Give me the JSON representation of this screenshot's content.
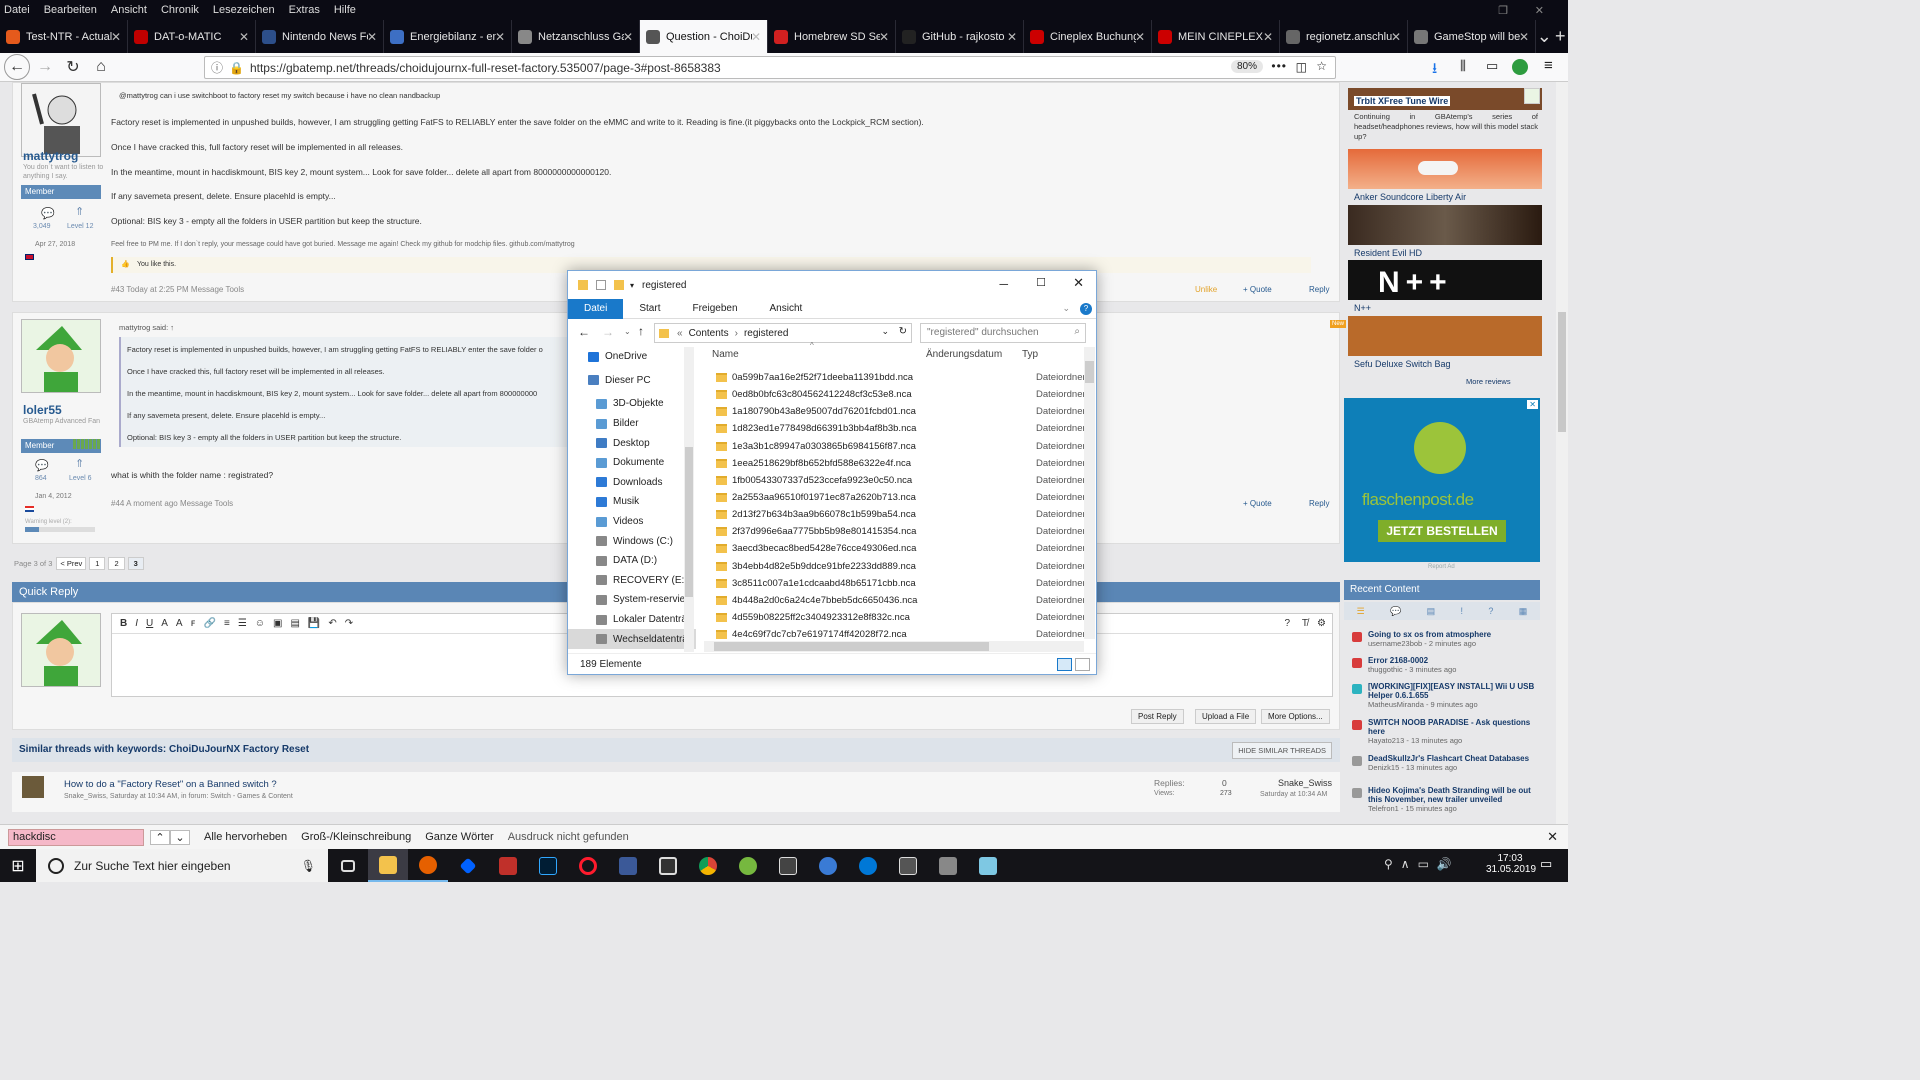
{
  "browser": {
    "menu": [
      "Datei",
      "Bearbeiten",
      "Ansicht",
      "Chronik",
      "Lesezeichen",
      "Extras",
      "Hilfe"
    ],
    "tabs": [
      {
        "label": "Test-NTR - Actual",
        "color": "#e55a1c"
      },
      {
        "label": "DAT-o-MATIC",
        "color": "#c00000"
      },
      {
        "label": "Nintendo News Fo",
        "color": "#2d4f8a"
      },
      {
        "label": "Energiebilanz - en",
        "color": "#3d6fc4"
      },
      {
        "label": "Netzanschluss Gas | Re",
        "color": "#888888"
      },
      {
        "label": "Question - ChoiDu",
        "color": "#555555",
        "active": true
      },
      {
        "label": "Homebrew SD Set",
        "color": "#d02020"
      },
      {
        "label": "GitHub - rajkosto",
        "color": "#222222"
      },
      {
        "label": "Cineplex Buchung",
        "color": "#cc0000"
      },
      {
        "label": "MEIN CINEPLEX -",
        "color": "#cc0000"
      },
      {
        "label": "regionetz.anschluss.to",
        "color": "#666666"
      },
      {
        "label": "GameStop will be",
        "color": "#777777"
      }
    ],
    "url": "https://gbatemp.net/threads/choidujournx-full-reset-factory.535007/page-3#post-8658383",
    "zoom": "80%"
  },
  "post1": {
    "user": "mattytrog",
    "user_title": "You don`t want to listen to anything I say.",
    "rank": "Member",
    "messages": "3,049",
    "level": "Level 12",
    "joined": "Apr 27, 2018",
    "quote_line": "@mattytrog can i use switchboot to factory reset my switch because i have no clean nandbackup",
    "lines": [
      "Factory reset is implemented in unpushed builds, however, I am struggling getting FatFS to RELIABLY enter the save folder on the eMMC and write to it. Reading is fine.(it piggybacks onto the Lockpick_RCM section).",
      "Once I have cracked this, full factory reset will be implemented in all releases.",
      "In the meantime, mount in hacdiskmount, BIS key 2, mount system... Look for save folder... delete all apart from 8000000000000120.",
      "If any savemeta present, delete. Ensure placehld is empty...",
      "Optional: BIS key 3 - empty all the folders in USER partition but keep the structure."
    ],
    "signature": "Feel free to PM me. If I don`t reply, your message could have got buried. Message me again! Check my github for modchip files. github.com/mattytrog",
    "likes": "You like this.",
    "footer": "#43   Today at 2:25 PM   Message Tools",
    "actions": [
      "Unlike",
      "+ Quote",
      "Reply"
    ]
  },
  "post2": {
    "user": "loler55",
    "user_title": "GBAtemp Advanced Fan",
    "rank": "Member",
    "messages": "864",
    "level": "Level 6",
    "joined": "Jan 4, 2012",
    "warning": "Warning level (2):",
    "quote_head": "mattytrog said: ↑",
    "quote_lines": [
      "Factory reset is implemented in unpushed builds, however, I am struggling getting FatFS to RELIABLY enter the save folder o",
      "Once I have cracked this, full factory reset will be implemented in all releases.",
      "In the meantime, mount in hacdiskmount, BIS key 2, mount system... Look for save folder... delete all apart from 800000000",
      "If any savemeta present, delete. Ensure placehld is empty...",
      "Optional: BIS key 3 - empty all the folders in USER partition but keep the structure."
    ],
    "text": "what is whith the folder name : registrated?",
    "footer": "#44   A moment ago   Message Tools",
    "actions": [
      "+ Quote",
      "Reply"
    ]
  },
  "pagination": {
    "label": "Page 3 of 3",
    "prev": "< Prev",
    "pages": [
      "1",
      "2",
      "3"
    ]
  },
  "quick_reply": {
    "title": "Quick Reply",
    "buttons": [
      "Post Reply",
      "Upload a File",
      "More Options..."
    ]
  },
  "similar": {
    "title": "Similar threads with keywords: ChoiDuJourNX Factory Reset",
    "hide": "HIDE SIMILAR THREADS",
    "thread_title": "How to do a \"Factory Reset\" on a Banned switch ?",
    "thread_meta": "Snake_Swiss, Saturday at 10:34 AM, in forum: Switch - Games & Content",
    "replies_label": "Replies:",
    "replies": "0",
    "views_label": "Views:",
    "views": "273",
    "last_user": "Snake_Swiss",
    "last_time": "Saturday at 10:34 AM"
  },
  "sidebar": {
    "reviews": [
      {
        "title": "Trblt XFree Tune Wire",
        "desc": "Continuing in GBAtemp's series of headset/headphones reviews, how will this model stack up?"
      },
      {
        "title": "Anker Soundcore Liberty Air"
      },
      {
        "title": "Resident Evil HD"
      },
      {
        "title": "N++"
      },
      {
        "title": "Sefu Deluxe Switch Bag"
      }
    ],
    "more_reviews": "More reviews",
    "new_badge": "New",
    "ad_brand": "flaschenpost.de",
    "ad_button": "JETZT BESTELLEN",
    "ad_report": "Report Ad",
    "recent_title": "Recent Content",
    "recent": [
      {
        "title": "Going to sx os from atmosphere",
        "meta": "username23bob - 2 minutes ago"
      },
      {
        "title": "Error 2168-0002",
        "meta": "thuggothic - 3 minutes ago"
      },
      {
        "title": "[WORKING][FIX][EASY INSTALL] Wii U USB Helper 0.6.1.655",
        "meta": "MatheusMiranda - 9 minutes ago"
      },
      {
        "title": "SWITCH NOOB PARADISE - Ask questions here",
        "meta": "Hayato213 - 13 minutes ago"
      },
      {
        "title": "DeadSkullzJr's Flashcart Cheat Databases",
        "meta": "Denizk15 - 13 minutes ago"
      },
      {
        "title": "Hideo Kojima's Death Stranding will be out this November, new trailer unveiled",
        "meta": "Telefron1 - 15 minutes ago"
      }
    ]
  },
  "explorer": {
    "title": "registered",
    "ribbon": [
      "Datei",
      "Start",
      "Freigeben",
      "Ansicht"
    ],
    "breadcrumb": [
      "Contents",
      "registered"
    ],
    "search_placeholder": "\"registered\" durchsuchen",
    "columns": [
      "Name",
      "Änderungsdatum",
      "Typ"
    ],
    "nav": [
      "OneDrive",
      "Dieser PC",
      "3D-Objekte",
      "Bilder",
      "Desktop",
      "Dokumente",
      "Downloads",
      "Musik",
      "Videos",
      "Windows (C:)",
      "DATA (D:)",
      "RECOVERY (E:)",
      "System-reservier",
      "Lokaler Datenträ",
      "Wechseldatenträ"
    ],
    "files": [
      "0a599b7aa16e2f52f71deeba11391bdd.nca",
      "0ed8b0bfc63c804562412248cf3c53e8.nca",
      "1a180790b43a8e95007dd76201fcbd01.nca",
      "1d823ed1e778498d66391b3bb4af8b3b.nca",
      "1e3a3b1c89947a0303865b6984156f87.nca",
      "1eea2518629bf8b652bfd588e6322e4f.nca",
      "1fb00543307337d523ccefa9923e0c50.nca",
      "2a2553aa96510f01971ec87a2620b713.nca",
      "2d13f27b634b3aa9b66078c1b599ba54.nca",
      "2f37d996e6aa7775bb5b98e801415354.nca",
      "3aecd3becac8bed5428e76cce49306ed.nca",
      "3b4ebb4d82e5b9ddce91bfe2233dd889.nca",
      "3c8511c007a1e1cdcaabd48b65171cbb.nca",
      "4b448a2d0c6a24c4e7bbeb5dc6650436.nca",
      "4d559b08225ff2c3404923312e8f832c.nca",
      "4e4c69f7dc7cb7e6197174ff42028f72.nca"
    ],
    "file_type": "Dateiordner",
    "status": "189 Elemente"
  },
  "findbar": {
    "value": "hackdisc",
    "options": [
      "Alle hervorheben",
      "Groß-/Kleinschreibung",
      "Ganze Wörter"
    ],
    "result": "Ausdruck nicht gefunden"
  },
  "taskbar": {
    "search_placeholder": "Zur Suche Text hier eingeben",
    "time": "17:03",
    "date": "31.05.2019"
  }
}
